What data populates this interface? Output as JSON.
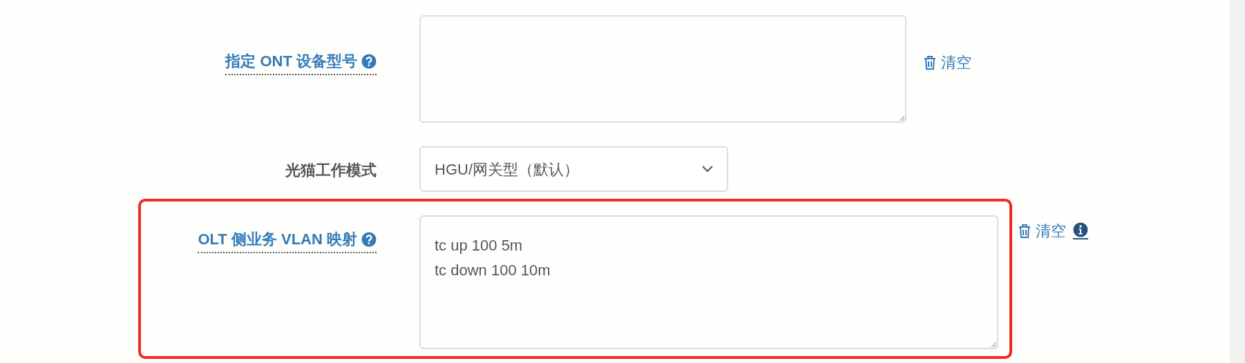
{
  "fields": [
    {
      "kind": "textarea",
      "label": "指定 ONT 设备型号",
      "link_label": true,
      "help": true,
      "clear": "清空",
      "info": false,
      "highlighted": false
    },
    {
      "kind": "select",
      "label": "光猫工作模式",
      "link_label": false,
      "value": "HGU/网关型（默认）",
      "highlighted": false
    },
    {
      "kind": "textarea",
      "label": "OLT 侧业务 VLAN 映射",
      "link_label": true,
      "help": true,
      "value": "tc up 100 5m\ntc down 100 10m",
      "clear": "清空",
      "info": true,
      "highlighted": true
    }
  ]
}
